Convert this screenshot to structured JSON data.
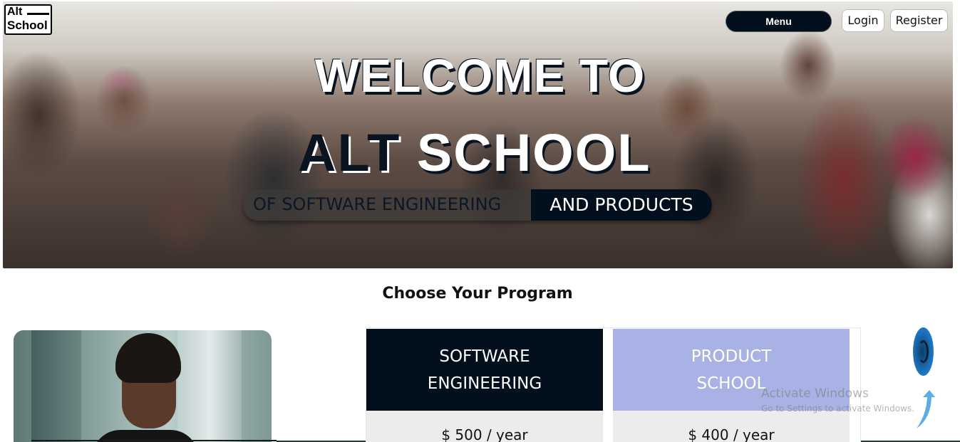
{
  "logo": {
    "line1": "Alt",
    "line2": "School"
  },
  "header": {
    "menu_label": "Menu",
    "login_label": "Login",
    "register_label": "Register"
  },
  "hero": {
    "title_line1": "WELCOME TO",
    "title_alt": "ALT",
    "title_school": "SCHOOL",
    "tagline_part1": "OF SOFTWARE ENGINEERING",
    "tagline_part2": "AND PRODUCTS"
  },
  "programs": {
    "section_title": "Choose Your Program",
    "cards": [
      {
        "name_line1": "SOFTWARE",
        "name_line2": "ENGINEERING",
        "price": "$ 500 / year",
        "color": "#020f1c"
      },
      {
        "name_line1": "PRODUCT",
        "name_line2": "SCHOOL",
        "price": "$ 400 / year",
        "color": "#a9b2e5"
      }
    ]
  },
  "floating": {
    "phone_icon": "phone-icon",
    "scroll_icon": "arrow-up-icon"
  },
  "watermark": {
    "line1": "Activate Windows",
    "line2": "Go to Settings to activate Windows."
  }
}
